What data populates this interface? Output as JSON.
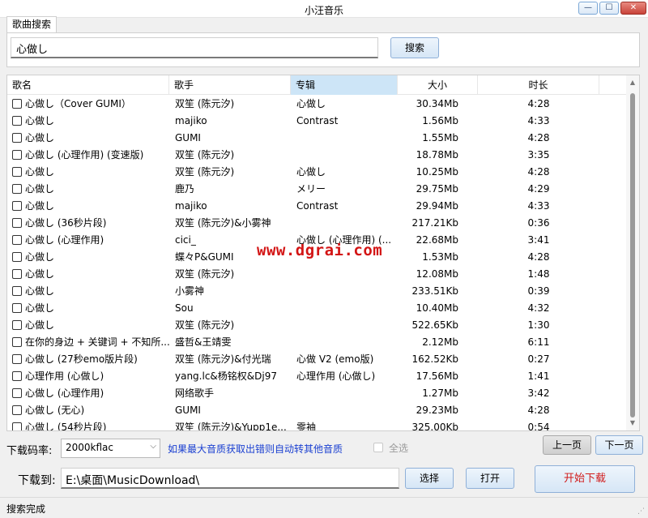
{
  "window": {
    "title": "小汪音乐",
    "minimize_glyph": "—",
    "maximize_glyph": "☐",
    "close_glyph": "✕"
  },
  "search": {
    "tab_label": "歌曲搜索",
    "query": "心做し",
    "button_label": "搜索"
  },
  "table": {
    "columns": [
      "歌名",
      "歌手",
      "专辑",
      "大小",
      "时长"
    ],
    "rows": [
      {
        "name": "心做し（Cover GUMI）",
        "artist": "双笙 (陈元汐)",
        "album": "心做し",
        "size": "30.34Mb",
        "duration": "4:28"
      },
      {
        "name": "心做し",
        "artist": "majiko",
        "album": "Contrast",
        "size": "1.56Mb",
        "duration": "4:33"
      },
      {
        "name": "心做し",
        "artist": "GUMI",
        "album": "",
        "size": "1.55Mb",
        "duration": "4:28"
      },
      {
        "name": "心做し (心理作用) (变速版)",
        "artist": "双笙 (陈元汐)",
        "album": "",
        "size": "18.78Mb",
        "duration": "3:35"
      },
      {
        "name": "心做し",
        "artist": "双笙 (陈元汐)",
        "album": "心做し",
        "size": "10.25Mb",
        "duration": "4:28"
      },
      {
        "name": "心做し",
        "artist": "鹿乃",
        "album": "メリー",
        "size": "29.75Mb",
        "duration": "4:29"
      },
      {
        "name": "心做し",
        "artist": "majiko",
        "album": "Contrast",
        "size": "29.94Mb",
        "duration": "4:33"
      },
      {
        "name": "心做し (36秒片段)",
        "artist": "双笙 (陈元汐)&小雾神",
        "album": "",
        "size": "217.21Kb",
        "duration": "0:36"
      },
      {
        "name": "心做し (心理作用)",
        "artist": "cici_",
        "album": "心做し (心理作用) (...",
        "size": "22.68Mb",
        "duration": "3:41"
      },
      {
        "name": "心做し",
        "artist": "蝶々P&GUMI",
        "album": "",
        "size": "1.53Mb",
        "duration": "4:28"
      },
      {
        "name": "心做し",
        "artist": "双笙 (陈元汐)",
        "album": "",
        "size": "12.08Mb",
        "duration": "1:48"
      },
      {
        "name": "心做し",
        "artist": "小雾神",
        "album": "",
        "size": "233.51Kb",
        "duration": "0:39"
      },
      {
        "name": "心做し",
        "artist": "Sou",
        "album": "",
        "size": "10.40Mb",
        "duration": "4:32"
      },
      {
        "name": "心做し",
        "artist": "双笙 (陈元汐)",
        "album": "",
        "size": "522.65Kb",
        "duration": "1:30"
      },
      {
        "name": "在你的身边 + 关键词 + 不知所...",
        "artist": "盛哲&王靖雯",
        "album": "",
        "size": "2.12Mb",
        "duration": "6:11"
      },
      {
        "name": "心做し (27秒emo版片段)",
        "artist": "双笙 (陈元汐)&付光瑞",
        "album": "心做 V2 (emo版)",
        "size": "162.52Kb",
        "duration": "0:27"
      },
      {
        "name": "心理作用 (心做し)",
        "artist": "yang.lc&杨铭权&Dj97",
        "album": "心理作用 (心做し)",
        "size": "17.56Mb",
        "duration": "1:41"
      },
      {
        "name": "心做し (心理作用)",
        "artist": "网络歌手",
        "album": "",
        "size": "1.27Mb",
        "duration": "3:42"
      },
      {
        "name": "心做し (无心)",
        "artist": "GUMI",
        "album": "",
        "size": "29.23Mb",
        "duration": "4:28"
      },
      {
        "name": "心做し (54秒片段)",
        "artist": "双笙 (陈元汐)&Yupp1e...",
        "album": "零袖",
        "size": "325.00Kb",
        "duration": "0:54"
      }
    ]
  },
  "watermark": "www.dgrai.com",
  "bitrate": {
    "label": "下载码率:",
    "value": "2000kflac",
    "notice": "如果最大音质获取出错则自动转其他音质"
  },
  "select_all_label": "全选",
  "pager": {
    "prev_label": "上一页",
    "next_label": "下一页"
  },
  "download": {
    "label": "下载到:",
    "path": "E:\\桌面\\MusicDownload\\",
    "browse_label": "选择",
    "open_label": "打开",
    "start_label": "开始下载"
  },
  "status": "搜索完成",
  "colors": {
    "accent": "#cde5f7",
    "notice": "#1a3fd1",
    "start_text": "#d11b1b",
    "watermark": "#d31515"
  }
}
